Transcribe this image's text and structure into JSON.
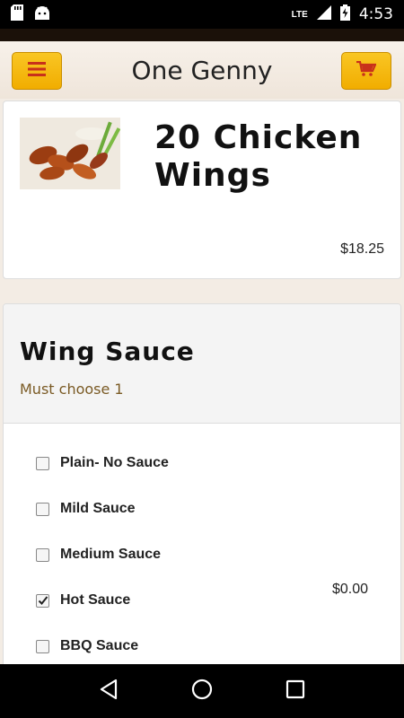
{
  "status_bar": {
    "network": "LTE",
    "time": "4:53",
    "icons": [
      "sd-card-icon",
      "android-icon",
      "signal-icon",
      "battery-charging-icon"
    ]
  },
  "header": {
    "title": "One Genny",
    "menu_icon": "hamburger-menu-icon",
    "cart_icon": "shopping-cart-icon",
    "accent_color": "#f5b800"
  },
  "item": {
    "name": "20 Chicken Wings",
    "price": "$18.25",
    "image": "chicken-wings-photo"
  },
  "sauce_section": {
    "title": "Wing Sauce",
    "requirement": "Must choose 1",
    "price": "$0.00",
    "options": [
      {
        "label": "Plain- No Sauce",
        "checked": false
      },
      {
        "label": "Mild Sauce",
        "checked": false
      },
      {
        "label": "Medium Sauce",
        "checked": false
      },
      {
        "label": "Hot Sauce",
        "checked": true
      },
      {
        "label": "BBQ Sauce",
        "checked": false
      }
    ]
  },
  "nav_bar": {
    "buttons": [
      "back-icon",
      "home-icon",
      "recents-icon"
    ]
  }
}
